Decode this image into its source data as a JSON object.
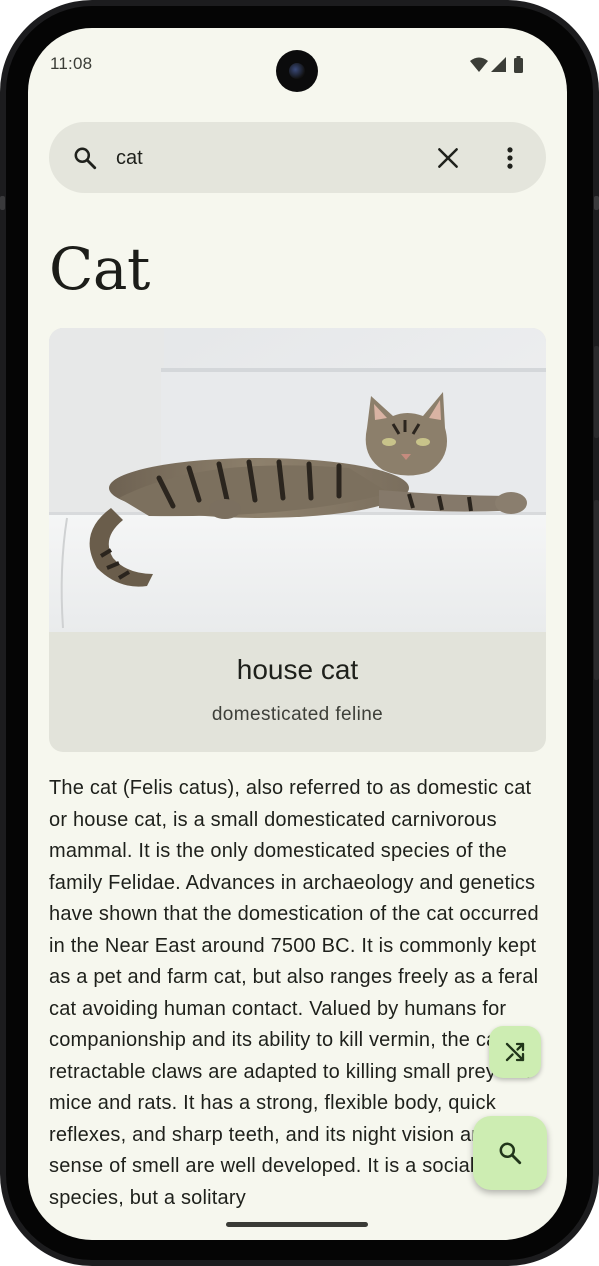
{
  "status_bar": {
    "time": "11:08",
    "icons": [
      "wifi-icon",
      "signal-icon",
      "battery-icon"
    ]
  },
  "search": {
    "query": "cat",
    "icons": {
      "leading": "search-icon",
      "clear": "close-icon",
      "menu": "more-vert-icon"
    }
  },
  "page": {
    "title": "Cat"
  },
  "card": {
    "image_alt": "cat-photo",
    "title": "house cat",
    "subtitle": "domesticated feline"
  },
  "article": {
    "text": "The cat (Felis catus), also referred to as domestic cat or house cat, is a small domesticated carnivorous mammal. It is the only domesticated species of the family Felidae. Advances in archaeology and genetics have shown that the domestication of the cat occurred in the Near East around 7500 BC. It is commonly kept as a pet and farm cat, but also ranges freely as a feral cat avoiding human contact. Valued by humans for companionship and its ability to kill vermin, the cat's retractable claws are adapted to killing small prey like mice and rats. It has a strong, flexible body, quick reflexes, and sharp teeth, and its night vision and sense of smell are well developed. It is a social species, but a solitary"
  },
  "fabs": {
    "random": "shuffle-icon",
    "search": "search-icon"
  },
  "colors": {
    "background": "#f6f7ee",
    "search_bar": "#e4e5dc",
    "card": "#e2e3da",
    "fab": "#cdedb2",
    "text": "#1e201b"
  }
}
